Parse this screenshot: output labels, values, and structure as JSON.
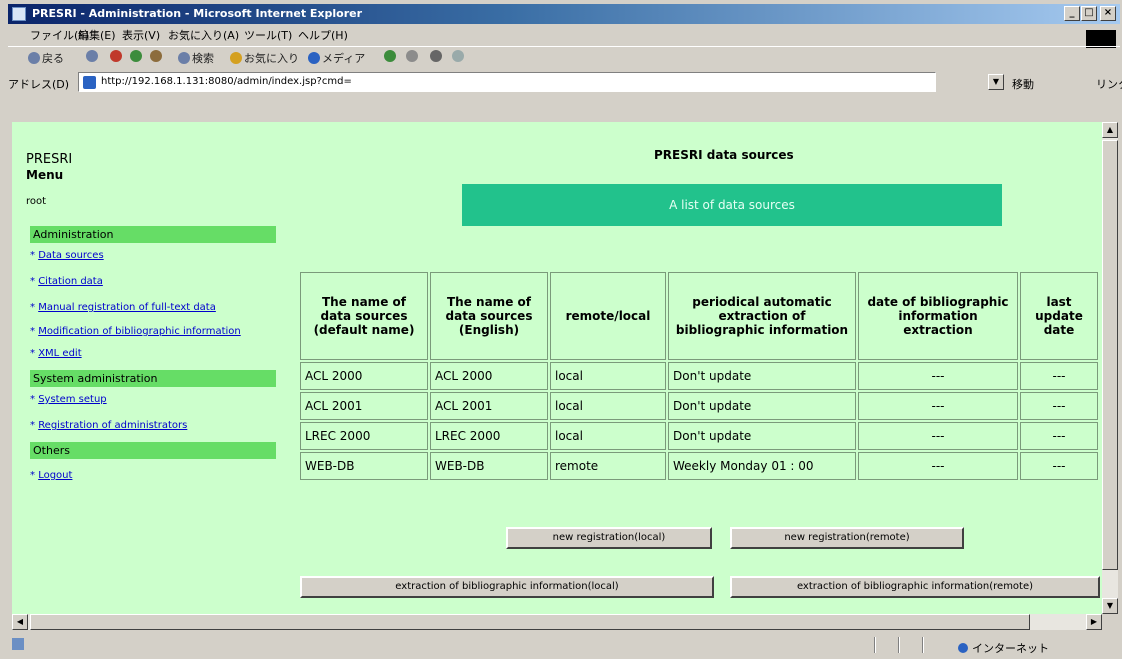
{
  "window": {
    "title": "PRESRI - Administration - Microsoft Internet Explorer",
    "minimize": "_",
    "maximize": "□",
    "close": "×"
  },
  "menubar": [
    "ファイル(F)",
    "編集(E)",
    "表示(V)",
    "お気に入り(A)",
    "ツール(T)",
    "ヘルプ(H)"
  ],
  "toolbar": {
    "back": "戻る",
    "search": "検索",
    "favorites": "お気に入り",
    "media": "メディア"
  },
  "address": {
    "label": "アドレス(D)",
    "url": "http://192.168.1.131:8080/admin/index.jsp?cmd=",
    "go": "移動",
    "links": "リンク"
  },
  "page": {
    "brand": "PRESRI",
    "menu_title": "Menu",
    "user": "root",
    "title": "PRESRI data sources",
    "banner": "A list of data sources"
  },
  "sidebar": {
    "sections": [
      {
        "header": "Administration",
        "links": [
          "Data sources",
          "Citation data",
          "Manual registration of full-text data",
          "Modification of bibliographic information",
          "XML edit"
        ]
      },
      {
        "header": "System administration",
        "links": [
          "System setup",
          "Registration of administrators"
        ]
      },
      {
        "header": "Others",
        "links": [
          "Logout"
        ]
      }
    ],
    "bullet": "*"
  },
  "table": {
    "headers": [
      "The name of data sources (default name)",
      "The name of data sources (English)",
      "remote/local",
      "periodical automatic extraction of bibliographic information",
      "date of bibliographic information extraction",
      "last update date"
    ],
    "rows": [
      [
        "ACL 2000",
        "ACL 2000",
        "local",
        "Don't update",
        "---",
        "---"
      ],
      [
        "ACL 2001",
        "ACL 2001",
        "local",
        "Don't update",
        "---",
        "---"
      ],
      [
        "LREC 2000",
        "LREC 2000",
        "local",
        "Don't update",
        "---",
        "---"
      ],
      [
        "WEB-DB",
        "WEB-DB",
        "remote",
        "Weekly Monday 01 : 00",
        "---",
        "---"
      ]
    ]
  },
  "buttons": {
    "new_local": "new registration(local)",
    "new_remote": "new registration(remote)",
    "extract_local": "extraction of bibliographic information(local)",
    "extract_remote": "extraction of bibliographic information(remote)"
  },
  "status": {
    "zone": "インターネット"
  }
}
